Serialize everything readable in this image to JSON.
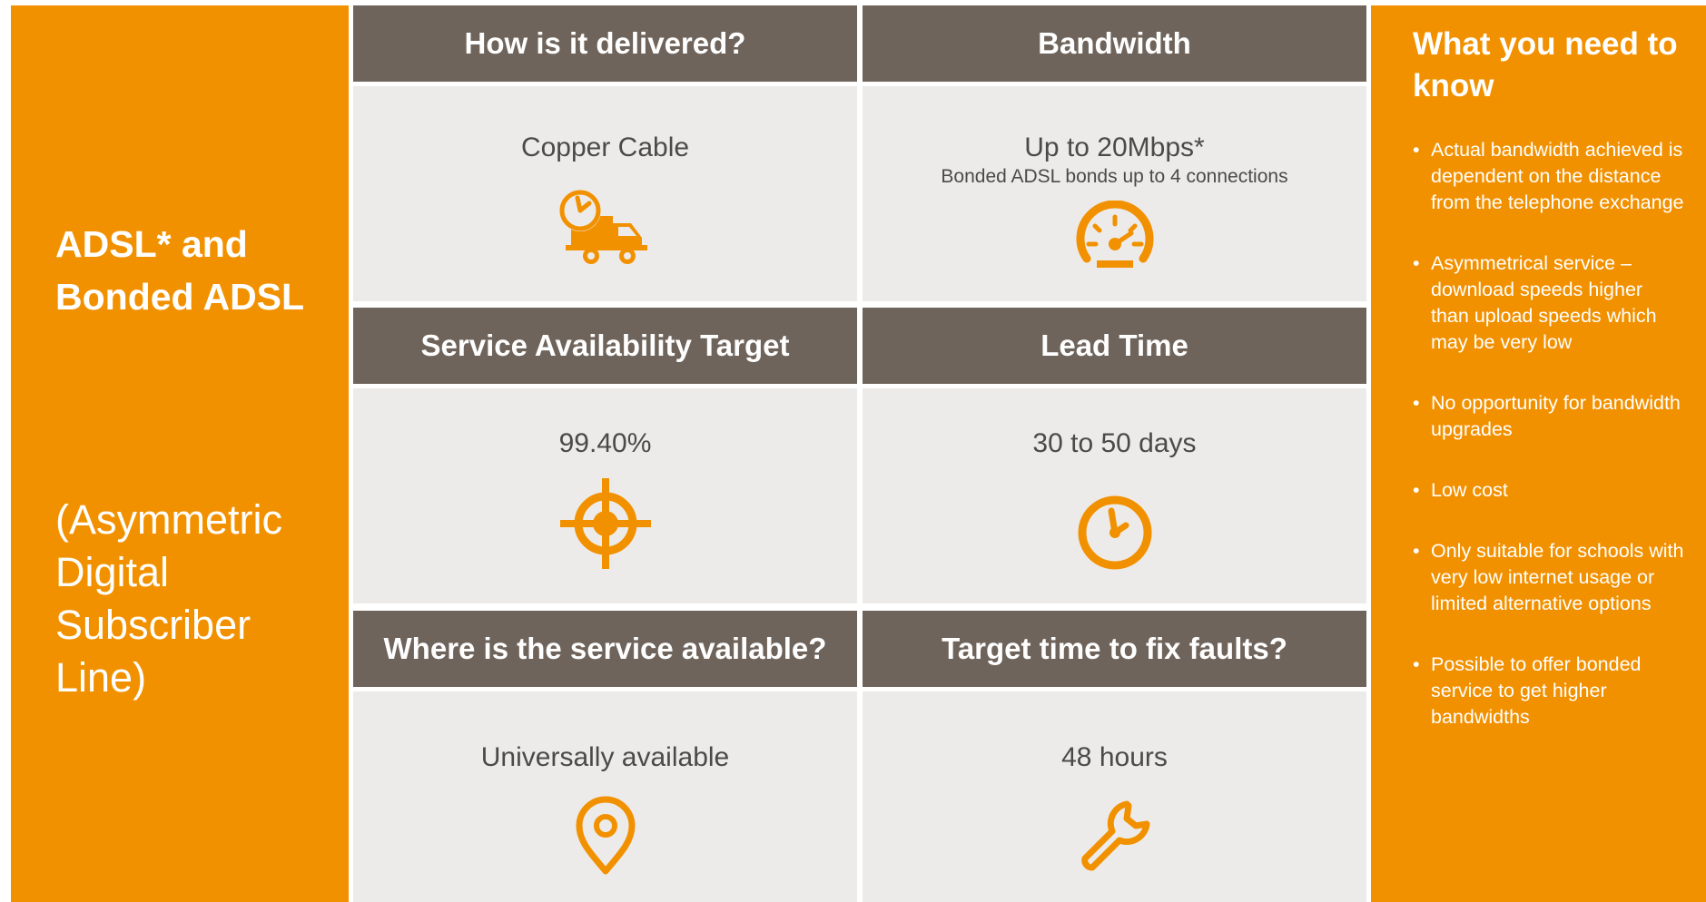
{
  "left": {
    "title": "ADSL* and Bonded ADSL",
    "subtitle": "(Asymmetric Digital Subscriber Line)"
  },
  "cells": [
    {
      "header": "How is it delivered?",
      "value": "Copper Cable",
      "note": "",
      "icon": "delivery-truck-clock-icon"
    },
    {
      "header": "Bandwidth",
      "value": "Up to 20Mbps*",
      "note": "Bonded ADSL bonds up to 4 connections",
      "icon": "speedometer-icon"
    },
    {
      "header": "Service Availability Target",
      "value": "99.40%",
      "note": "",
      "icon": "target-crosshair-icon"
    },
    {
      "header": "Lead Time",
      "value": "30 to 50 days",
      "note": "",
      "icon": "clock-icon"
    },
    {
      "header": "Where is the service available?",
      "value": "Universally available",
      "note": "",
      "icon": "location-pin-icon"
    },
    {
      "header": "Target time to fix faults?",
      "value": "48 hours",
      "note": "",
      "icon": "wrench-icon"
    }
  ],
  "right": {
    "heading": "What you need to know",
    "bullets": [
      "Actual bandwidth achieved is dependent on the distance from the telephone exchange",
      "Asymmetrical service – download speeds higher than upload speeds which may be very low",
      "No opportunity for bandwidth upgrades",
      "Low cost",
      "Only suitable for schools with very low internet usage or limited alternative options",
      "Possible to offer bonded service to get higher bandwidths"
    ]
  },
  "colors": {
    "orange": "#F29100",
    "header_brown": "#6F645B",
    "cell_bg": "#EDEBE9"
  }
}
